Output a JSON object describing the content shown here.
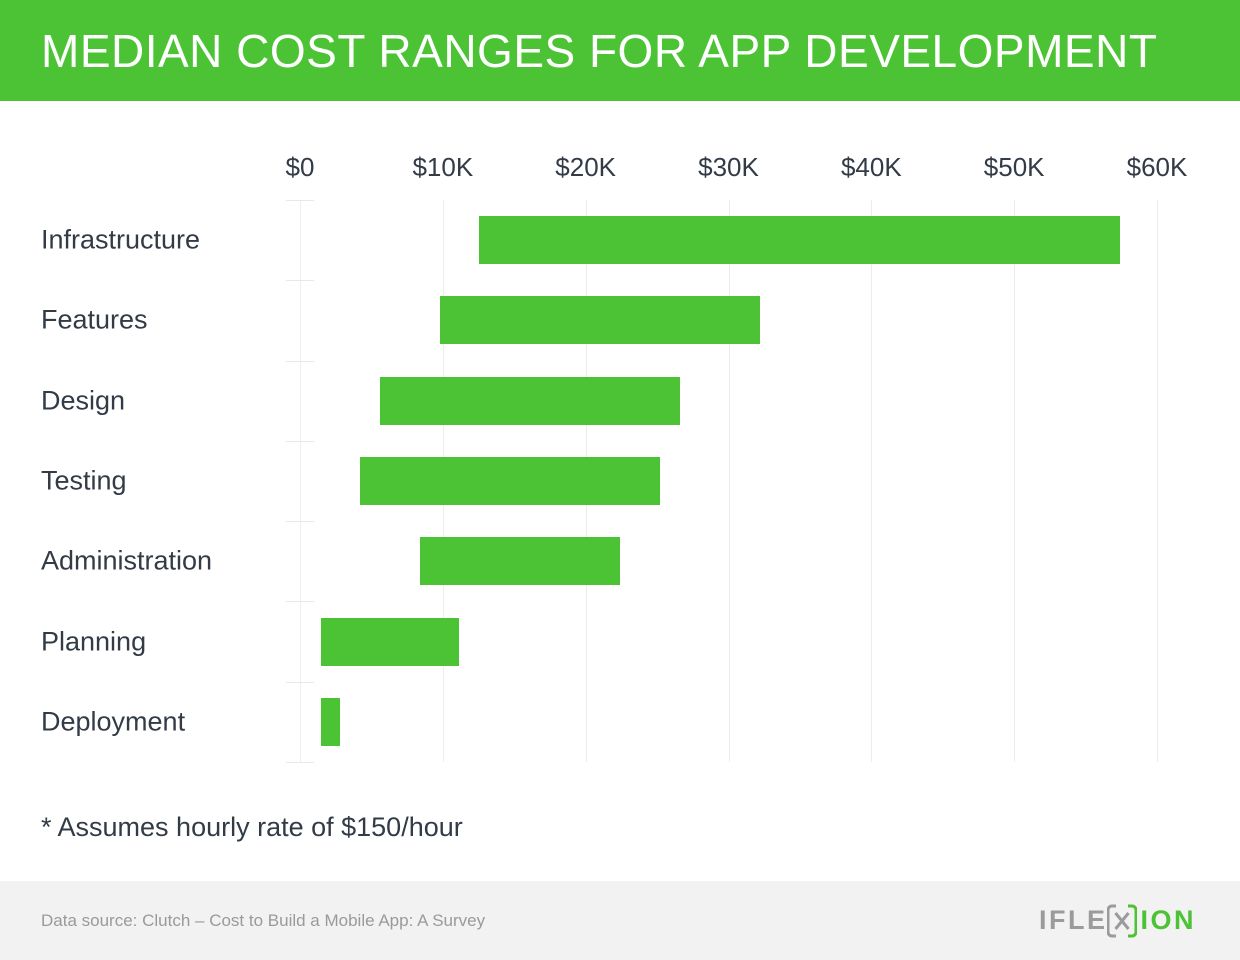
{
  "header": {
    "title": "MEDIAN COST RANGES FOR APP DEVELOPMENT",
    "background_color": "#4CC335",
    "text_color": "#FFFFFF"
  },
  "footnote": "* Assumes hourly rate of $150/hour",
  "footer": {
    "source": "Data source: Clutch – Cost to Build a Mobile App: A Survey",
    "background_color": "#F2F2F2",
    "logo": {
      "text_left": "IFLE",
      "mark": "X",
      "text_right": "ION",
      "left_color": "#9B9B9B",
      "right_color": "#4CC335"
    }
  },
  "chart_data": {
    "type": "bar",
    "orientation": "horizontal",
    "subtype": "range-bar",
    "title": "MEDIAN COST RANGES FOR APP DEVELOPMENT",
    "xlabel": "",
    "ylabel": "",
    "xlim": [
      0,
      60000
    ],
    "xtick_values": [
      0,
      10000,
      20000,
      30000,
      40000,
      50000,
      60000
    ],
    "xtick_labels": [
      "$0",
      "$10K",
      "$20K",
      "$30K",
      "$40K",
      "$50K",
      "$60K"
    ],
    "grid": true,
    "legend": false,
    "bar_color": "#4CC335",
    "note": "* Assumes hourly rate of $150/hour",
    "categories": [
      "Infrastructure",
      "Features",
      "Design",
      "Testing",
      "Administration",
      "Planning",
      "Deployment"
    ],
    "ranges": [
      {
        "category": "Infrastructure",
        "low": 12500,
        "high": 57400
      },
      {
        "category": "Features",
        "low": 9800,
        "high": 32200
      },
      {
        "category": "Design",
        "low": 5600,
        "high": 26600
      },
      {
        "category": "Testing",
        "low": 4200,
        "high": 25200
      },
      {
        "category": "Administration",
        "low": 8400,
        "high": 22400
      },
      {
        "category": "Planning",
        "low": 1500,
        "high": 11100
      },
      {
        "category": "Deployment",
        "low": 1500,
        "high": 2800
      }
    ]
  }
}
